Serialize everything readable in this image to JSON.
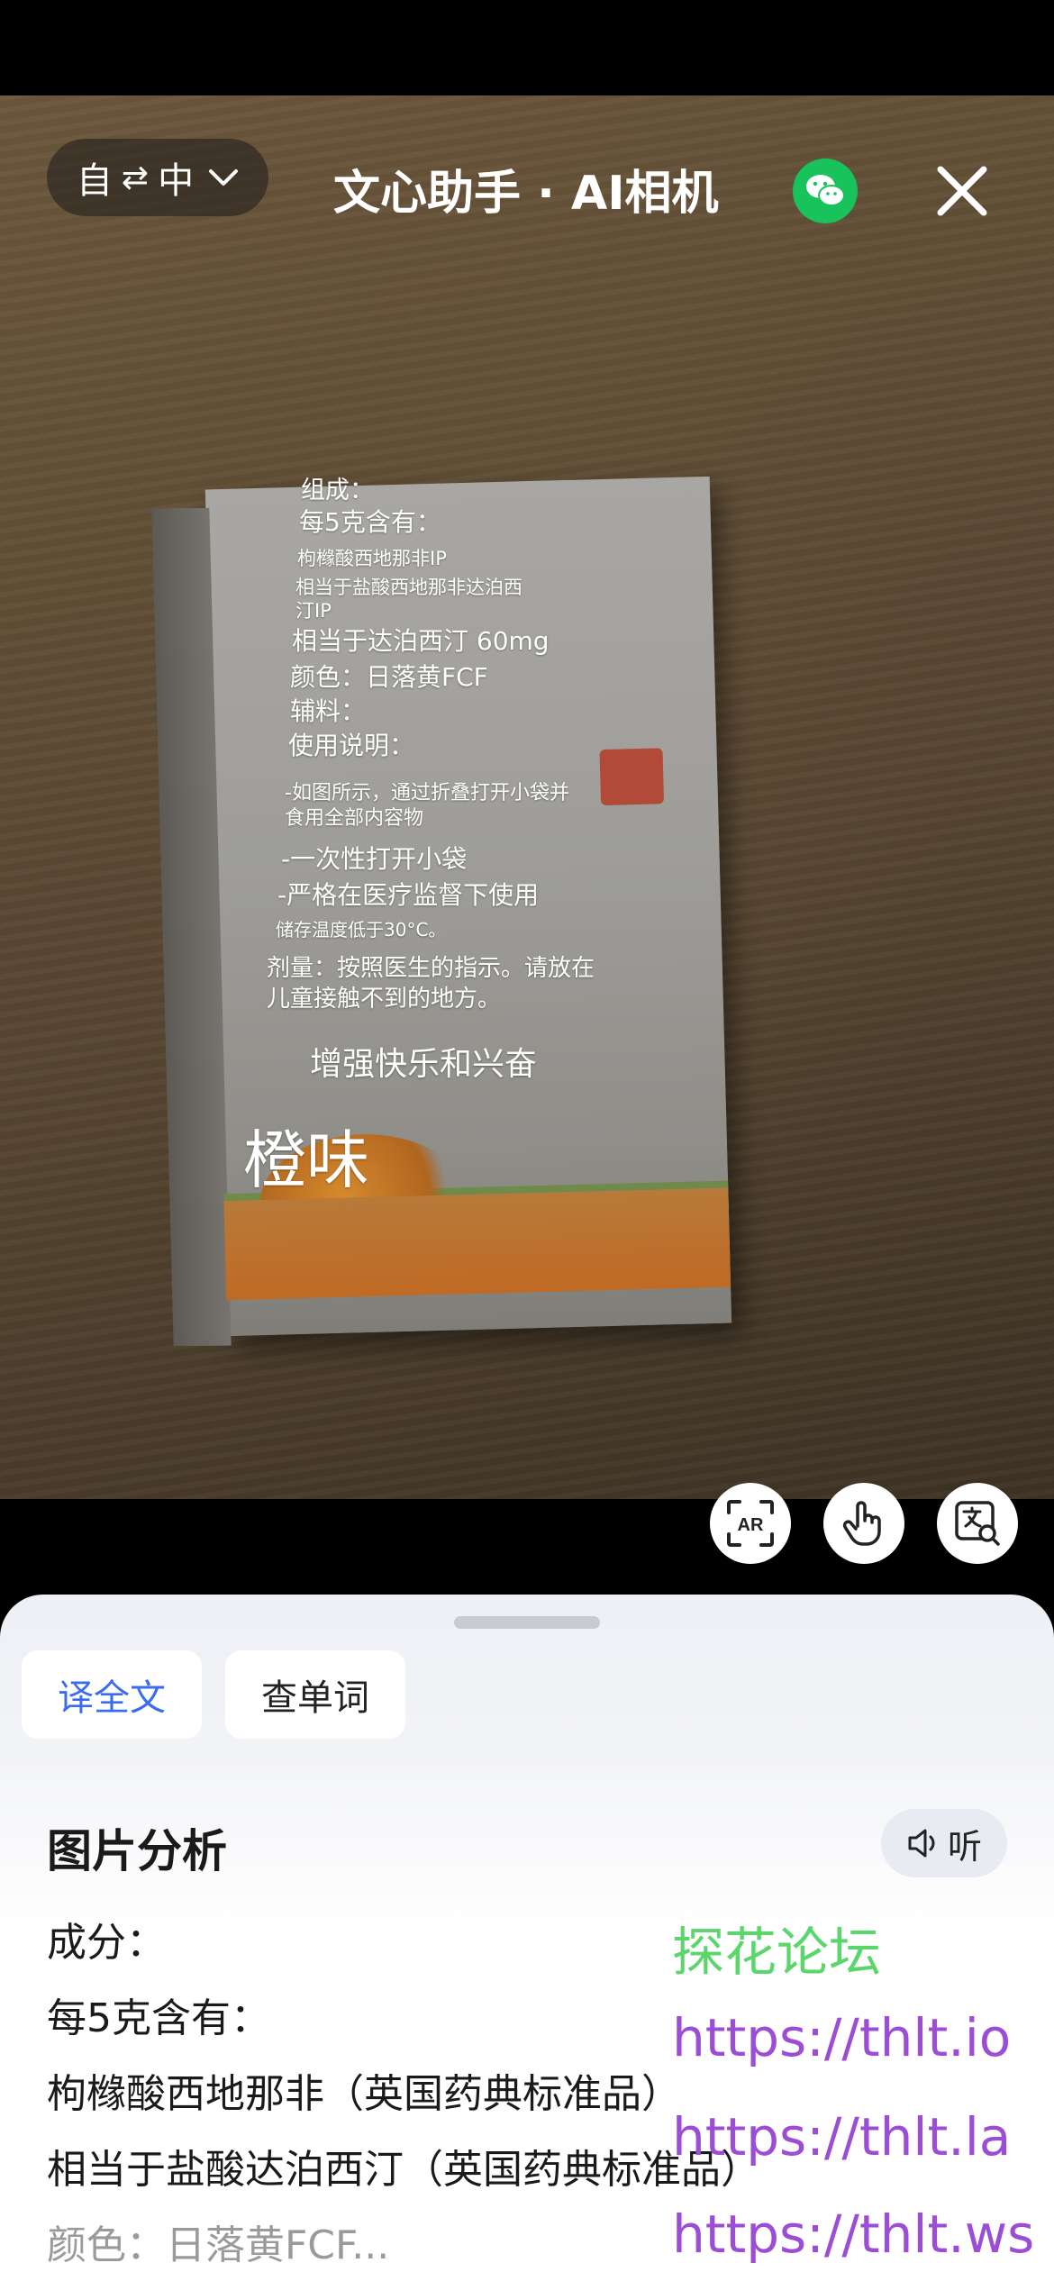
{
  "header": {
    "lang_from": "自",
    "lang_swap": "⇄",
    "lang_to": "中",
    "title": "文心助手 · AI相机"
  },
  "overlay": {
    "lines": [
      "组成：",
      "每5克含有：",
      "枸橼酸西地那非IP",
      "相当于盐酸西地那非达泊西",
      "汀IP",
      "相当于达泊西汀 60mg",
      "颜色：日落黄FCF",
      "辅料：",
      "使用说明：",
      "-如图所示，通过折叠打开小袋并",
      "食用全部内容物",
      "-一次性打开小袋",
      "-严格在医疗监督下使用",
      "储存温度低于30°C。",
      "剂量：按照医生的指示。请放在",
      "儿童接触不到的地方。",
      "增强快乐和兴奋",
      "橙味"
    ]
  },
  "tools": {
    "ar_label": "AR"
  },
  "sheet": {
    "chip_full_translate": "译全文",
    "chip_lookup_word": "查单词",
    "section_title": "图片分析",
    "listen_label": "听",
    "results": [
      "成分：",
      "每5克含有：",
      "枸橼酸西地那非（英国药典标准品）",
      "相当于盐酸达泊西汀（英国药典标准品）",
      "颜色：日落黄FCF..."
    ]
  },
  "watermark": {
    "forum": "探花论坛",
    "url1": "https://thlt.io",
    "url2": "https://thlt.la",
    "url3": "https://thlt.ws"
  },
  "colors": {
    "accent_blue": "#3b6cf0",
    "wechat_green": "#19c35c",
    "watermark_green": "#5ad66a",
    "watermark_purple": "#9b4dd6",
    "watermark_red": "#e8383a"
  }
}
